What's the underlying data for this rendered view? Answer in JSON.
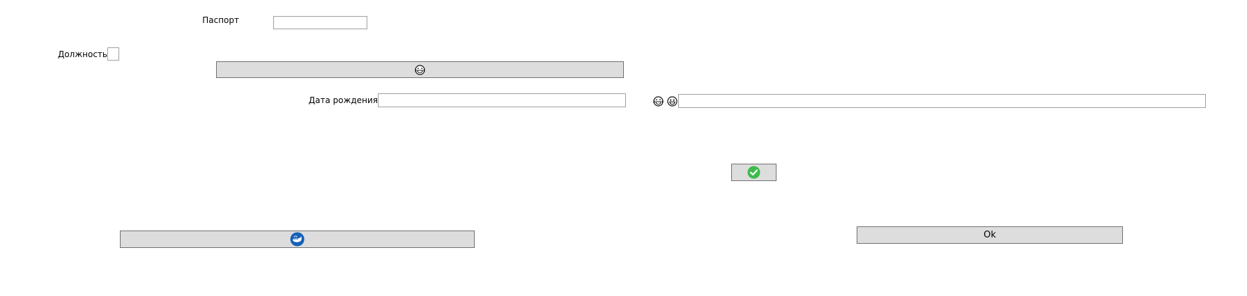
{
  "form": {
    "passport": {
      "label": "Паспорт",
      "value": ""
    },
    "position": {
      "label": "Должность",
      "value": ""
    },
    "birth_date": {
      "label": "Дата рождения",
      "value": ""
    },
    "emoji_field": {
      "value": ""
    }
  },
  "buttons": {
    "emoji_button": {
      "icon": "grinning-tears-emoji-icon"
    },
    "confirm_button": {
      "icon": "green-check-circle-icon",
      "color": "#3dbb4a"
    },
    "whale_button": {
      "icon": "blue-whale-circle-icon",
      "color": "#1560b8"
    },
    "ok_button": {
      "label": "Ok"
    }
  },
  "emoji_pair": [
    "grinning-tears-emoji-icon",
    "grinning-face-emoji-icon"
  ]
}
